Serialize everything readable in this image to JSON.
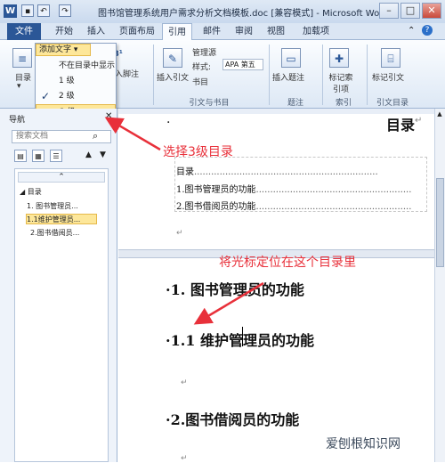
{
  "window": {
    "title": "图书馆管理系统用户需求分析文档模板.doc [兼容模式] - Microsoft Word",
    "app_icon": "W",
    "minimize": "–",
    "maximize": "□",
    "close": "✕"
  },
  "tabs": {
    "file": "文件",
    "items": [
      "开始",
      "插入",
      "页面布局",
      "引用",
      "邮件",
      "审阅",
      "视图",
      "加载项"
    ],
    "active": "引用"
  },
  "ribbon": {
    "toc_button": "目录",
    "add_text": "添加文字",
    "add_text_icon": "▾",
    "insert_footnote": "插入脚注",
    "insert_citation": "插入引文",
    "manage_sources": "管理源",
    "style_label": "样式:",
    "style_value": "APA 第五",
    "bibliography": "书目",
    "insert_caption": "插入题注",
    "mark_entry": "标记索引项",
    "mark_citation": "标记引文",
    "groups": [
      "引文与书目",
      "题注",
      "索引",
      "引文目录"
    ]
  },
  "dropdown": {
    "items": [
      "不在目录中显示",
      "1 级",
      "2 级",
      "3 级"
    ],
    "checked": "2 级",
    "highlighted": "3 级"
  },
  "nav": {
    "title": "导航",
    "search_placeholder": "搜索文档",
    "search_icon": "⌕",
    "tree": [
      "目录",
      "1. 图书管理员...",
      "1.1维护管理员...",
      "2.图书借阅员..."
    ],
    "expand_icon": "⌃"
  },
  "document": {
    "toc_title": "目录",
    "toc_entries": [
      "目录",
      "1.图书管理员的功能",
      "2.图书借阅员的功能"
    ],
    "heading1": "1. 图书管理员的功能",
    "heading2": "1.1 维护管理员的功能",
    "heading3": "2.图书借阅员的功能"
  },
  "annotations": {
    "note1": "选择3级目录",
    "note2": "将光标定位在这个目录里",
    "color": "#e8303a"
  },
  "watermark": "爱刨根知识网"
}
